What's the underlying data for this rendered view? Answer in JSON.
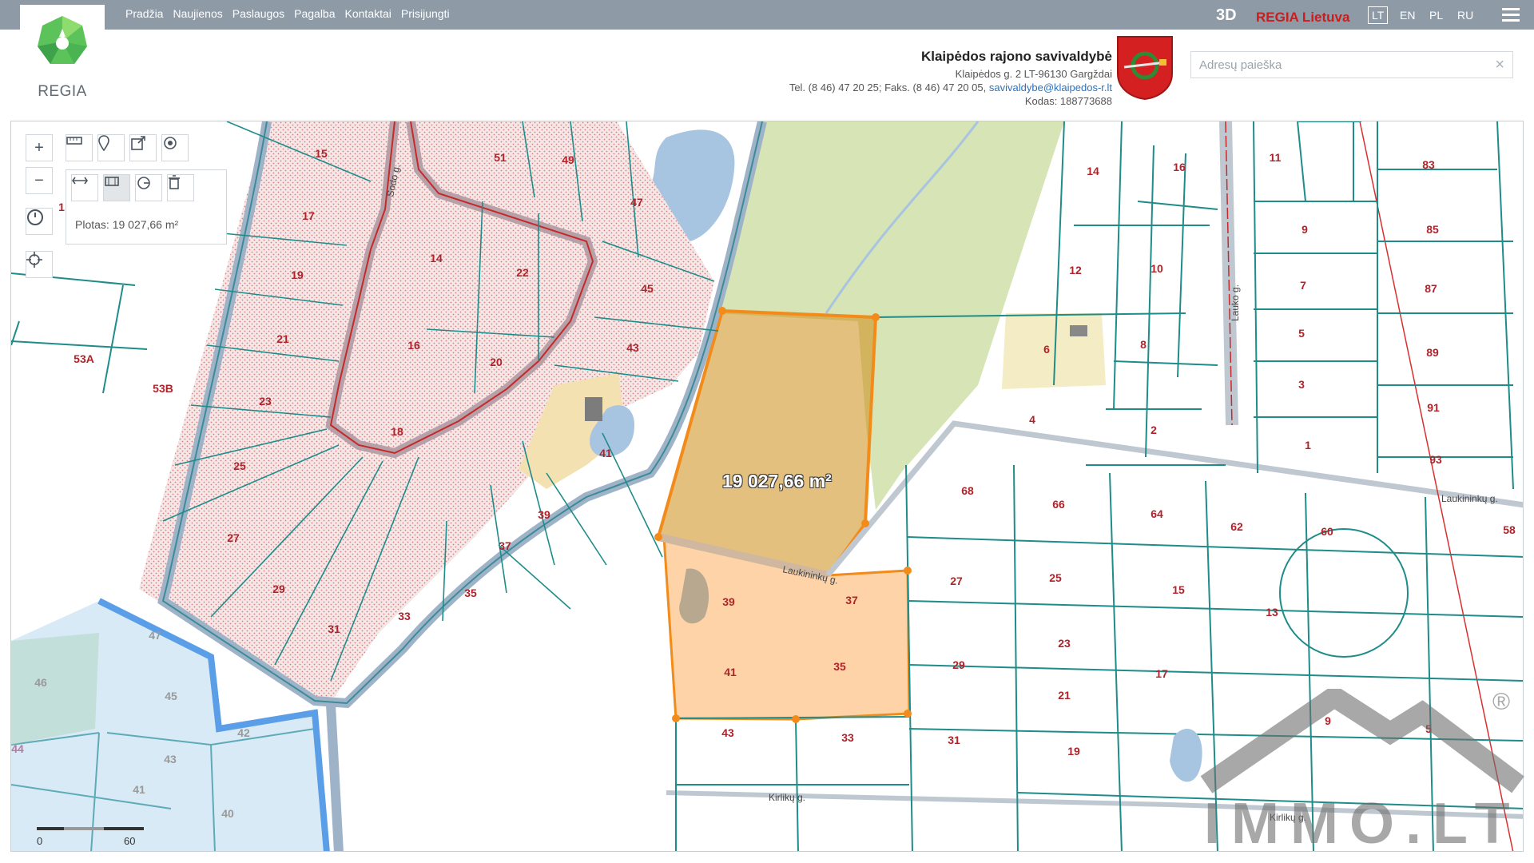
{
  "nav": [
    "Pradžia",
    "Naujienos",
    "Paslaugos",
    "Pagalba",
    "Kontaktai",
    "Prisijungti"
  ],
  "logo": {
    "text": "REGIA"
  },
  "top_right": {
    "btn_3d": "3D",
    "regia": "REGIA Lietuva",
    "languages": [
      "LT",
      "EN",
      "PL",
      "RU"
    ],
    "active_language": "LT"
  },
  "municipality": {
    "name": "Klaipėdos rajono savivaldybė",
    "address": "Klaipėdos g. 2 LT-96130 Gargždai",
    "phone": "Tel. (8 46) 47 20 25; Faks. (8 46) 47 20 05,",
    "email": "savivaldybe@klaipedos-r.lt",
    "code": "Kodas: 188773688"
  },
  "search": {
    "placeholder": "Adresų paieška",
    "clear": "×"
  },
  "measure": {
    "readout": "Plotas: 19 027,66 m²",
    "map_label": "19 027,66 m²"
  },
  "scale": {
    "zero": "0",
    "distance": "60 m"
  },
  "streets": {
    "sodo": "Sodo g.",
    "laukininku_main": "Laukininkų g.",
    "laukininku_east": "Laukininkų g.",
    "lauko": "Lauko g.",
    "kirliku": "Kirlikų g.",
    "kirliku_east": "Kirlikų g."
  },
  "parcels": {
    "p15": "15",
    "p51": "51",
    "p49": "49",
    "p17": "17",
    "p19": "19",
    "p21": "21",
    "p23": "23",
    "p25": "25",
    "p27": "27",
    "p29": "29",
    "p31": "31",
    "p33": "33",
    "p35w": "35",
    "p37w": "37",
    "p14w": "14",
    "p22": "22",
    "p16w": "16",
    "p20": "20",
    "p18": "18",
    "p45": "45",
    "p43": "43",
    "p47": "47",
    "p41w": "41",
    "p39w": "39",
    "p53A": "53A",
    "p53B": "53B",
    "p14e": "14",
    "p16e": "16",
    "p11": "11",
    "p83": "83",
    "p12": "12",
    "p10": "10",
    "p9": "9",
    "p85": "85",
    "p7": "7",
    "p87": "87",
    "p6": "6",
    "p8": "8",
    "p5": "5",
    "p89": "89",
    "p3": "3",
    "p91": "91",
    "p4": "4",
    "p2": "2",
    "p1": "1",
    "p93": "93",
    "p68": "68",
    "p66": "66",
    "p64": "64",
    "p62": "62",
    "p60": "60",
    "p58": "58",
    "p39s": "39",
    "p37s": "37",
    "p27e": "27",
    "p25e": "25",
    "p15e": "15",
    "p13": "13",
    "p41s": "41",
    "p35s": "35",
    "p29e": "29",
    "p23e": "23",
    "p21e": "21",
    "p17e": "17",
    "p43s": "43",
    "p33s": "33",
    "p31e": "31",
    "p19e": "19",
    "p9e": "9",
    "p5e": "5",
    "p46": "46",
    "p45s": "45",
    "p42": "42",
    "p43sw": "43",
    "p44": "44",
    "p41sw": "41",
    "p40": "40",
    "p47sw": "47",
    "p1w": "1"
  },
  "watermark": {
    "text": "IMMO.LT",
    "reg": "®"
  }
}
